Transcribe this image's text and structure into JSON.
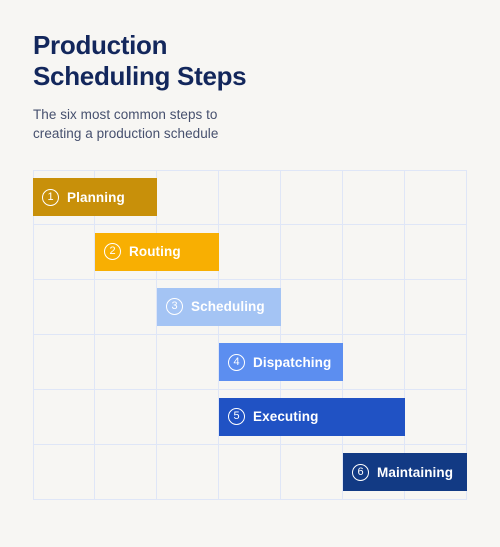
{
  "page": {
    "background_color": "#f7f6f3"
  },
  "header": {
    "title": "Production\nScheduling Steps",
    "title_color": "#13275c",
    "subtitle": "The six most common steps to\ncreating a production schedule",
    "subtitle_color": "#46506e"
  },
  "chart_data": {
    "type": "bar",
    "title": "Production Scheduling Steps",
    "subtitle": "The six most common steps to creating a production schedule",
    "orientation": "horizontal",
    "grid": true,
    "grid_columns": 7,
    "grid_rows": 6,
    "grid_color": "#dfe6f7",
    "xlabel": "",
    "ylabel": "",
    "legend": "none",
    "categories": [
      "Planning",
      "Routing",
      "Scheduling",
      "Dispatching",
      "Executing",
      "Maintaining"
    ],
    "series": [
      {
        "name": "Production scheduling steps",
        "values": [
          2,
          2,
          2,
          2,
          3,
          2
        ]
      }
    ],
    "bars": [
      {
        "number": "1",
        "label": "Planning",
        "row": 1,
        "start_col": 0,
        "span_cols": 2,
        "color": "#c8900a"
      },
      {
        "number": "2",
        "label": "Routing",
        "row": 2,
        "start_col": 1,
        "span_cols": 2,
        "color": "#f8af02"
      },
      {
        "number": "3",
        "label": "Scheduling",
        "row": 3,
        "start_col": 2,
        "span_cols": 2,
        "color": "#a4c4f4"
      },
      {
        "number": "4",
        "label": "Dispatching",
        "row": 4,
        "start_col": 3,
        "span_cols": 2,
        "color": "#5c8ef0"
      },
      {
        "number": "5",
        "label": "Executing",
        "row": 5,
        "start_col": 3,
        "span_cols": 3,
        "color": "#2052c4"
      },
      {
        "number": "6",
        "label": "Maintaining",
        "row": 6,
        "start_col": 5,
        "span_cols": 2,
        "color": "#123a84"
      }
    ]
  }
}
